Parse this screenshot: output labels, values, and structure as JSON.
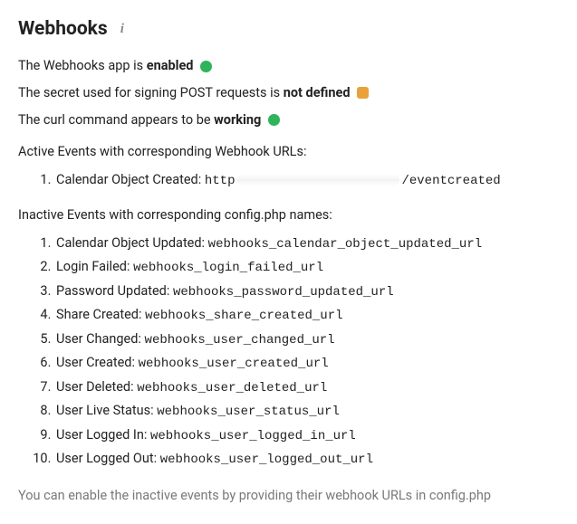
{
  "heading": "Webhooks",
  "status": {
    "app_prefix": "The Webhooks app is ",
    "app_state": "enabled",
    "secret_prefix": "The secret used for signing POST requests is ",
    "secret_state": "not defined",
    "curl_prefix": "The curl command appears to be ",
    "curl_state": "working"
  },
  "active_label": "Active Events with corresponding Webhook URLs:",
  "active_events": [
    {
      "label": "Calendar Object Created:",
      "url_prefix": "http",
      "url_suffix": "/eventcreated"
    }
  ],
  "inactive_label": "Inactive Events with corresponding config.php names:",
  "inactive_events": [
    {
      "label": "Calendar Object Updated:",
      "config": "webhooks_calendar_object_updated_url"
    },
    {
      "label": "Login Failed:",
      "config": "webhooks_login_failed_url"
    },
    {
      "label": "Password Updated:",
      "config": "webhooks_password_updated_url"
    },
    {
      "label": "Share Created:",
      "config": "webhooks_share_created_url"
    },
    {
      "label": "User Changed:",
      "config": "webhooks_user_changed_url"
    },
    {
      "label": "User Created:",
      "config": "webhooks_user_created_url"
    },
    {
      "label": "User Deleted:",
      "config": "webhooks_user_deleted_url"
    },
    {
      "label": "User Live Status:",
      "config": "webhooks_user_status_url"
    },
    {
      "label": "User Logged In:",
      "config": "webhooks_user_logged_in_url"
    },
    {
      "label": "User Logged Out:",
      "config": "webhooks_user_logged_out_url"
    }
  ],
  "footer": "You can enable the inactive events by providing their webhook URLs in config.php"
}
